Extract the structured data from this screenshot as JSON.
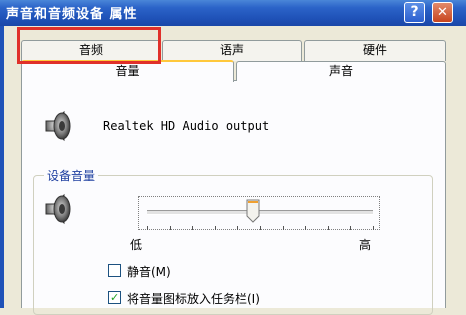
{
  "window": {
    "title": "声音和音频设备 属性",
    "help_label": "?",
    "close_label": "✕"
  },
  "tabs": {
    "row1": [
      {
        "label": "音频"
      },
      {
        "label": "语声"
      },
      {
        "label": "硬件"
      }
    ],
    "row2": [
      {
        "label": "音量",
        "active": true
      },
      {
        "label": "声音"
      }
    ]
  },
  "device": {
    "name": "Realtek HD Audio output",
    "icon": "speaker-icon"
  },
  "volume_group": {
    "label": "设备音量",
    "icon": "speaker-icon",
    "slider": {
      "value_fraction": 0.47
    },
    "low_label": "低",
    "high_label": "高",
    "mute": {
      "label": "静音(M)",
      "checked": false
    },
    "taskbar_icon": {
      "label": "将音量图标放入任务栏(I)",
      "checked": true
    }
  },
  "colors": {
    "titlebar": "#2b63c8",
    "highlight": "#e0302a",
    "active_tab_top": "#ffc83c"
  }
}
